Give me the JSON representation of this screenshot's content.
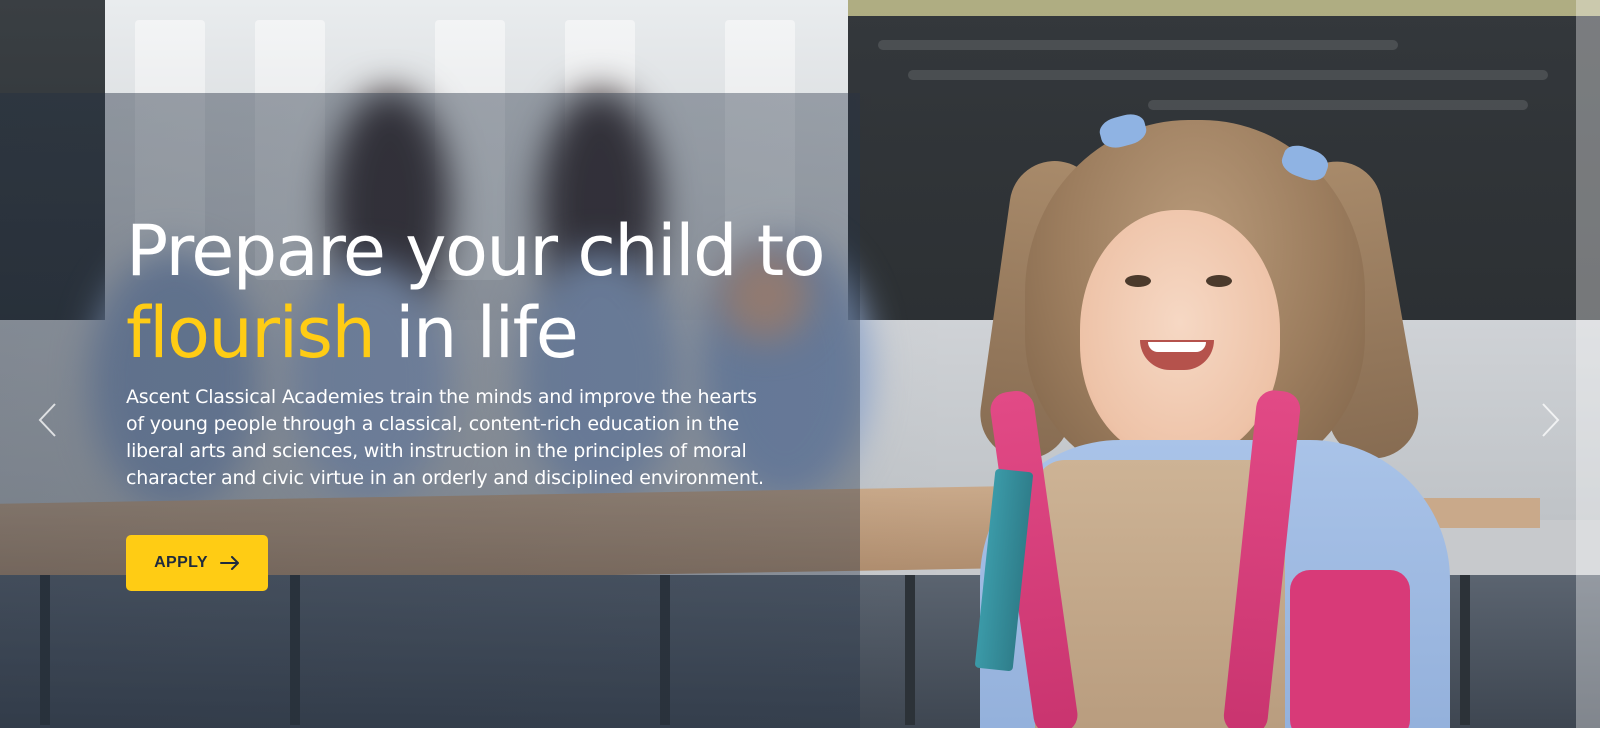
{
  "hero": {
    "headline_line1": "Prepare your child to",
    "headline_accent": "flourish",
    "headline_rest": " in life",
    "description": "Ascent Classical Academies train the minds and improve the hearts of young people through a classical, content-rich education in the liberal arts and sciences, with instruction in the principles of moral character and civic virtue in an orderly and disciplined environment.",
    "apply_label": "APPLY",
    "apply_icon": "arrow-right-icon"
  },
  "slider": {
    "prev_icon": "chevron-left-icon",
    "next_icon": "chevron-right-icon"
  },
  "colors": {
    "accent": "#ffcc14",
    "button_text": "#1f2b3d",
    "text": "#ffffff",
    "overlay": "rgba(40, 52, 70, 0.38)"
  }
}
